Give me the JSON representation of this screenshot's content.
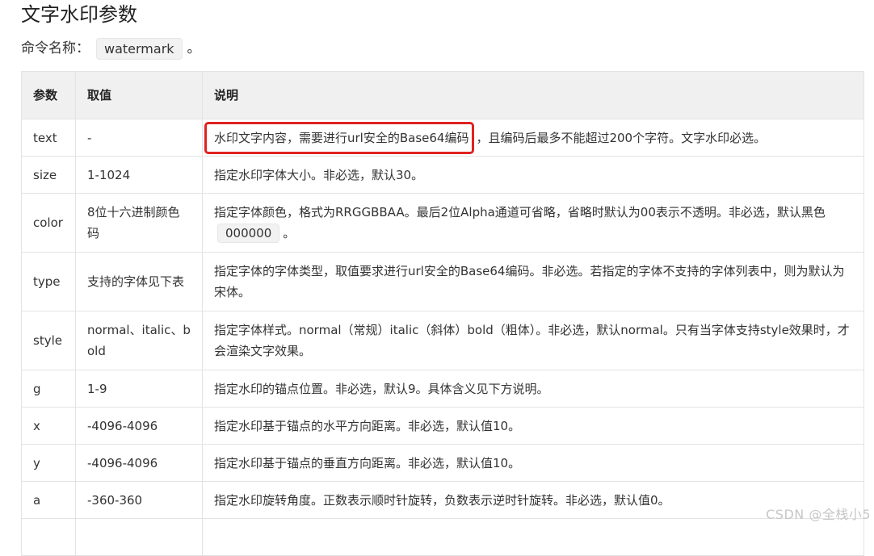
{
  "page": {
    "title": "文字水印参数",
    "command_label": "命令名称：",
    "command_value": "watermark",
    "command_suffix": "。"
  },
  "table": {
    "headers": [
      "参数",
      "取值",
      "说明"
    ],
    "rows": [
      {
        "param": "text",
        "value": "-",
        "desc_highlight": "水印文字内容，需要进行url安全的Base64编码",
        "desc": "，且编码后最多不能超过200个字符。文字水印必选。"
      },
      {
        "param": "size",
        "value": "1-1024",
        "desc": "指定水印字体大小。非必选，默认30。"
      },
      {
        "param": "color",
        "value": "8位十六进制颜色码",
        "desc": "指定字体颜色，格式为RRGGBBAA。最后2位Alpha通道可省略，省略时默认为00表示不透明。非必选，默认黑色",
        "desc_code": "000000",
        "desc_suffix": "。"
      },
      {
        "param": "type",
        "value": "支持的字体见下表",
        "desc": "指定字体的字体类型，取值要求进行url安全的Base64编码。非必选。若指定的字体不支持的字体列表中，则为默认为宋体。"
      },
      {
        "param": "style",
        "value": "normal、italic、bold",
        "desc": "指定字体样式。normal（常规）italic（斜体）bold（粗体）。非必选，默认normal。只有当字体支持style效果时，才会渲染文字效果。"
      },
      {
        "param": "g",
        "value": "1-9",
        "desc": "指定水印的锚点位置。非必选，默认9。具体含义见下方说明。"
      },
      {
        "param": "x",
        "value": "-4096-4096",
        "desc": "指定水印基于锚点的水平方向距离。非必选，默认值10。"
      },
      {
        "param": "y",
        "value": "-4096-4096",
        "desc": "指定水印基于锚点的垂直方向距离。非必选，默认值10。"
      },
      {
        "param": "a",
        "value": "-360-360",
        "desc": "指定水印旋转角度。正数表示顺时针旋转，负数表示逆时针旋转。非必选，默认值0。"
      }
    ]
  },
  "watermark_text": "CSDN @全栈小5",
  "colors": {
    "highlight_border": "#e0221f",
    "header_bg": "#f0f0f0",
    "code_bg": "#f2f2f2"
  }
}
